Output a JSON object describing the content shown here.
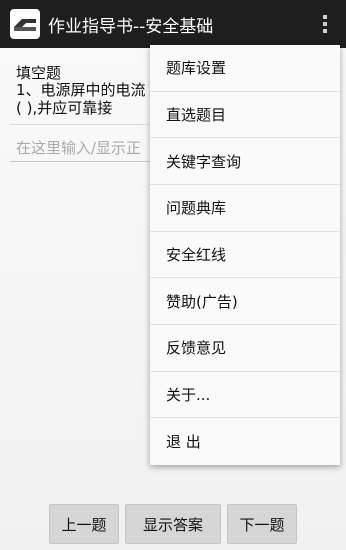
{
  "app_bar": {
    "title": "作业指导书--安全基础",
    "icon": "app-logo-icon",
    "overflow_icon": "more-vertical-icon",
    "background": "#1e1e1e"
  },
  "question": {
    "type": "填空题",
    "text": "1、电源屏中的电流\n(   ),并应可靠接"
  },
  "answer_input": {
    "placeholder": "在这里输入/显示正"
  },
  "buttons": {
    "prev": "上一题",
    "show_answer": "显示答案",
    "next": "下一题"
  },
  "menu": {
    "items": [
      {
        "label": "题库设置"
      },
      {
        "label": "直选题目"
      },
      {
        "label": "关键字查询"
      },
      {
        "label": "问题典库"
      },
      {
        "label": "安全红线"
      },
      {
        "label": "赞助(广告)"
      },
      {
        "label": "反馈意见"
      },
      {
        "label": "关于..."
      },
      {
        "label": "退 出"
      }
    ]
  }
}
